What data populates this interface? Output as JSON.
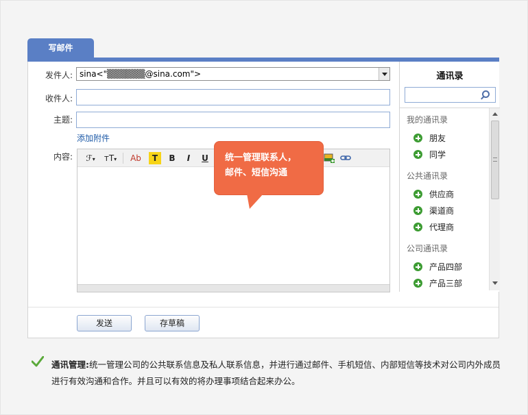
{
  "tab": {
    "label": "写邮件"
  },
  "form": {
    "from_label": "发件人:",
    "from_value": "sina<\"▒▒▒▒▒▒@sina.com\">",
    "to_label": "收件人:",
    "to_value": "",
    "subject_label": "主题:",
    "subject_value": "",
    "attach_link": "添加附件",
    "content_label": "内容:"
  },
  "toolbar": {
    "font_family": "ℱ",
    "font_size": "тT",
    "text_color": "Ab",
    "highlight": "T",
    "bold": "B",
    "italic": "I",
    "underline": "U"
  },
  "callout": {
    "line1": "统一管理联系人，",
    "line2": "邮件、短信沟通"
  },
  "contacts": {
    "title": "通讯录",
    "search_value": "",
    "groups": [
      {
        "name": "我的通讯录",
        "items": [
          "朋友",
          "同学"
        ]
      },
      {
        "name": "公共通讯录",
        "items": [
          "供应商",
          "渠道商",
          "代理商"
        ]
      },
      {
        "name": "公司通讯录",
        "items": [
          "产品四部",
          "产品三部"
        ]
      }
    ]
  },
  "buttons": {
    "send": "发送",
    "draft": "存草稿"
  },
  "description": {
    "title": "通讯管理:",
    "text": "统一管理公司的公共联系信息及私人联系信息，并进行通过邮件、手机短信、内部短信等技术对公司内外成员进行有效沟通和合作。并且可以有效的将办理事项结合起来办公。"
  },
  "colors": {
    "accent": "#5a7fc5",
    "callout": "#f06b45",
    "add": "#3d9c33",
    "check": "#5aa93a",
    "link": "#1f5ba8"
  }
}
